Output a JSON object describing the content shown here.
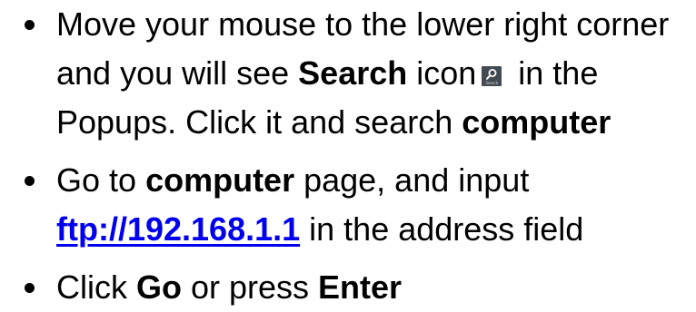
{
  "steps": [
    {
      "line1": "Move your mouse to the lower right corner",
      "line2_a": "and you will see ",
      "line2_bold": "Search",
      "line2_b": " icon",
      "line2_c": " in the",
      "search_icon": {
        "name": "search-charm-icon",
        "caption": "Search",
        "background": "#444a52"
      },
      "line3_a": "Popups. Click it and search ",
      "line3_bold": "computer"
    },
    {
      "line1_a": "Go to ",
      "line1_bold": "computer",
      "line1_b": " page, and input",
      "link": "ftp://192.168.1.1",
      "line2_b": " in the address field"
    },
    {
      "a": "Click ",
      "bold1": "Go",
      "b": " or press ",
      "bold2": "Enter"
    }
  ],
  "colors": {
    "text": "#000000",
    "link": "#0000ee",
    "background": "#ffffff"
  }
}
